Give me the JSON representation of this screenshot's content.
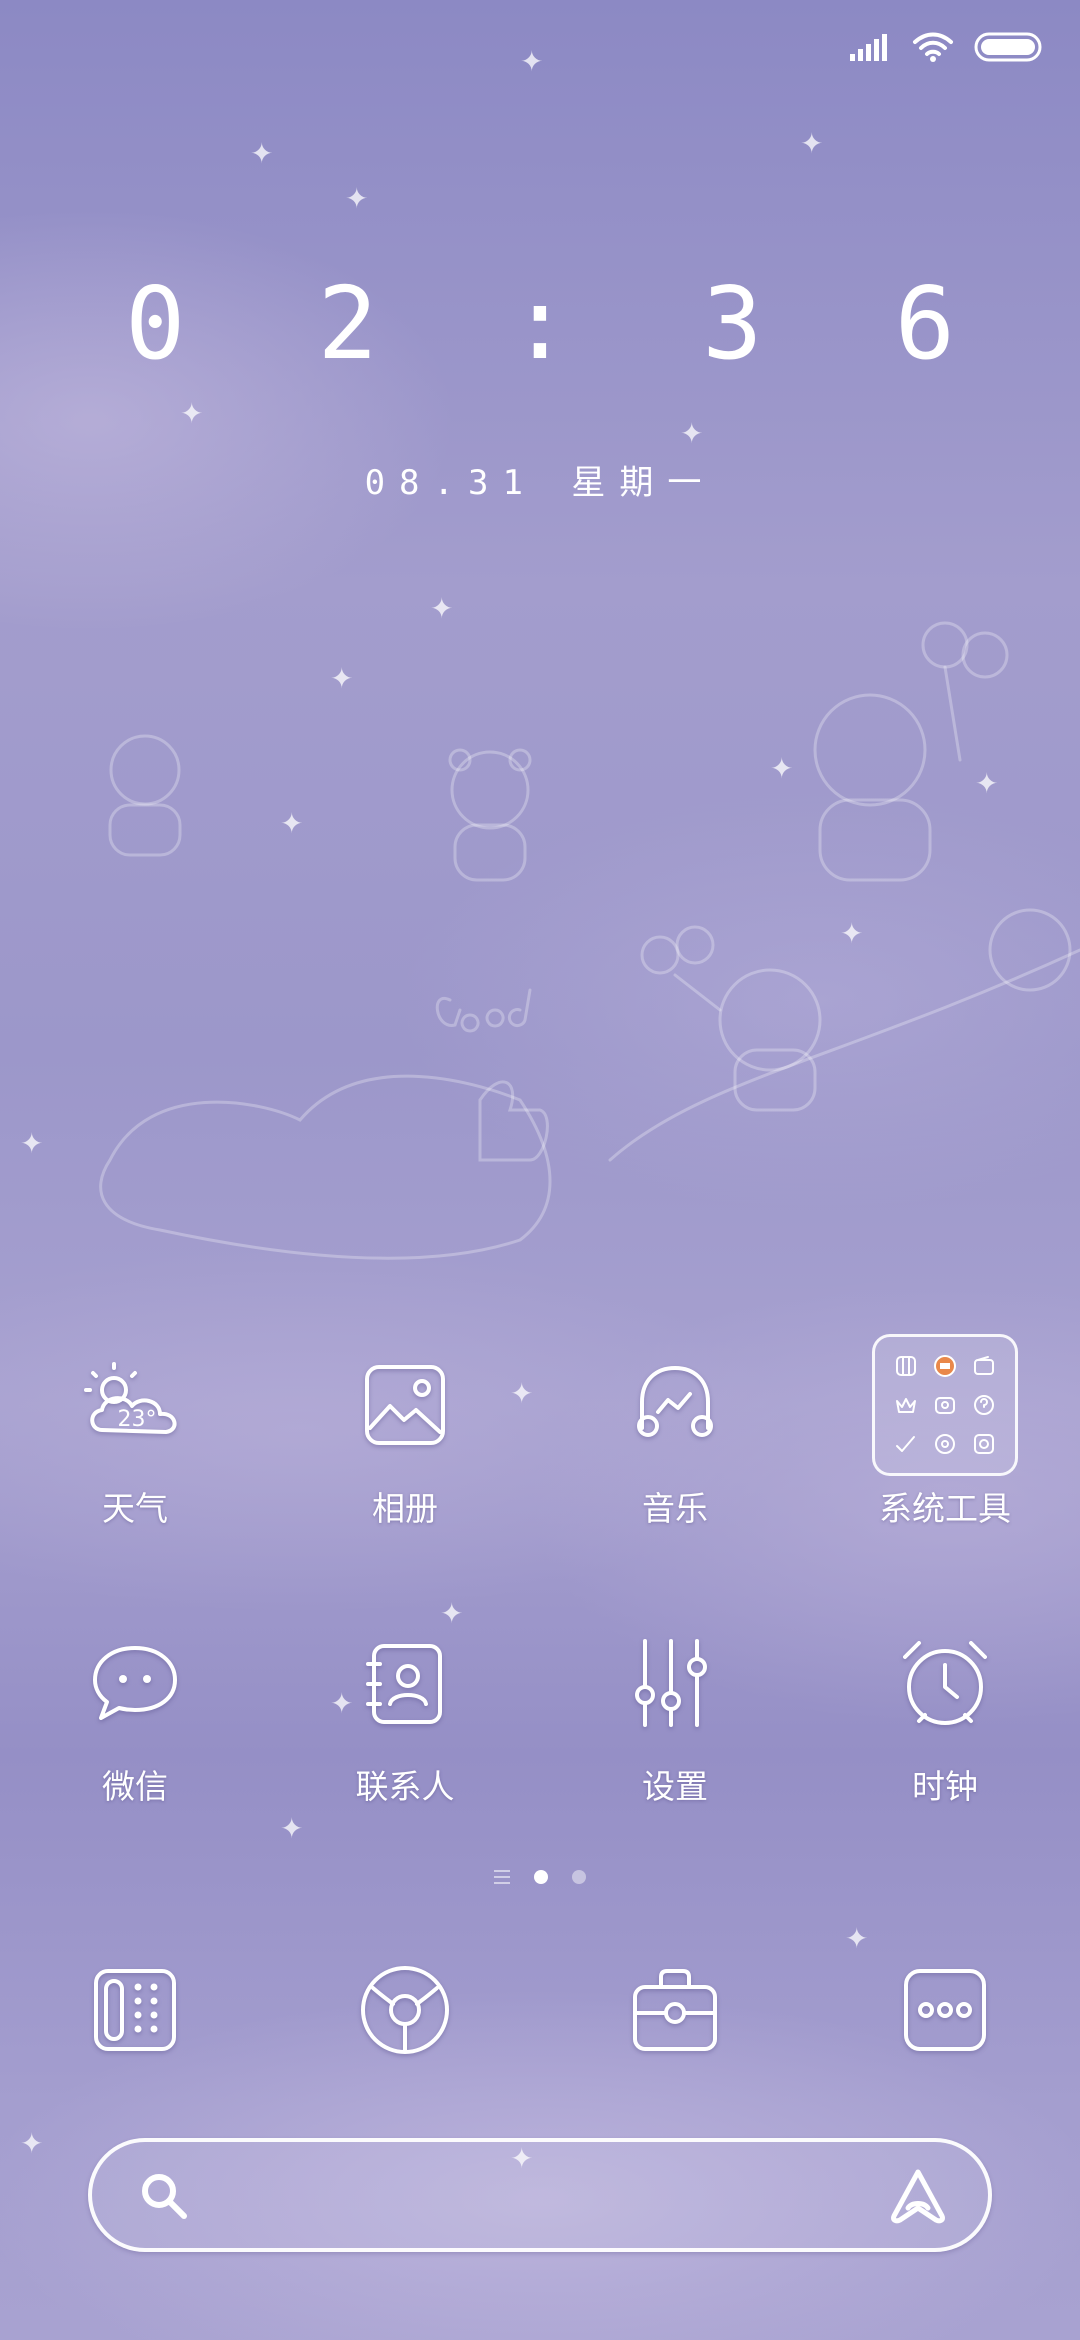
{
  "status_bar": {
    "signal_icon": "cellular-signal-icon",
    "wifi_icon": "wifi-icon",
    "battery_icon": "battery-icon"
  },
  "clock": {
    "time": "0 2 : 3 6",
    "date": "08.31 星期一"
  },
  "apps_row1": [
    {
      "label": "天气",
      "icon": "weather-icon",
      "icon_text": "23°"
    },
    {
      "label": "相册",
      "icon": "gallery-icon"
    },
    {
      "label": "音乐",
      "icon": "music-icon"
    },
    {
      "label": "系统工具",
      "icon": "folder-icon"
    }
  ],
  "apps_row2": [
    {
      "label": "微信",
      "icon": "chat-bubble-icon"
    },
    {
      "label": "联系人",
      "icon": "contacts-icon"
    },
    {
      "label": "设置",
      "icon": "sliders-icon"
    },
    {
      "label": "时钟",
      "icon": "alarm-clock-icon"
    }
  ],
  "pager": {
    "page_count": 2,
    "active_page": 1
  },
  "dock": [
    {
      "icon": "phone-keypad-icon"
    },
    {
      "icon": "browser-icon"
    },
    {
      "icon": "toolbox-icon"
    },
    {
      "icon": "more-dots-icon"
    }
  ],
  "search_bar": {
    "icon": "search-icon",
    "assistant_icon": "assistant-icon"
  },
  "colors": {
    "background_top": "#8c89c4",
    "background_mid": "#a39dcd",
    "foreground": "#ffffff"
  }
}
